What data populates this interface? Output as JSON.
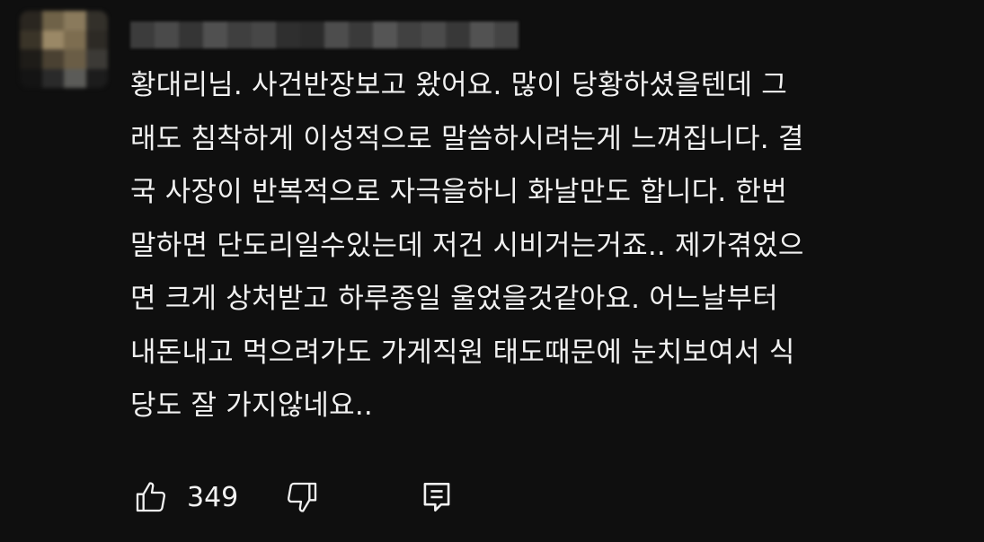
{
  "comment": {
    "lines": [
      "황대리님. 사건반장보고 왔어요. 많이 당황하셨을텐데 그",
      "래도 침착하게 이성적으로 말씀하시려는게 느껴집니다. 결",
      "국 사장이 반복적으로 자극을하니 화날만도 합니다. 한번",
      "말하면 단도리일수있는데 저건 시비거는거죠.. 제가겪었으",
      "면 크게 상처받고 하루종일 울었을것같아요. 어느날부터",
      "내돈내고 먹으려가도 가게직원 태도때문에 눈치보여서 식",
      "당도 잘 가지않네요.."
    ]
  },
  "actions": {
    "like_count": "349",
    "like_icon": "thumbs-up-icon",
    "dislike_icon": "thumbs-down-icon",
    "reply_icon": "reply-comment-icon"
  },
  "colors": {
    "background": "#0f0f0f",
    "text": "#f1f1f1",
    "icon": "#f1f1f1"
  }
}
